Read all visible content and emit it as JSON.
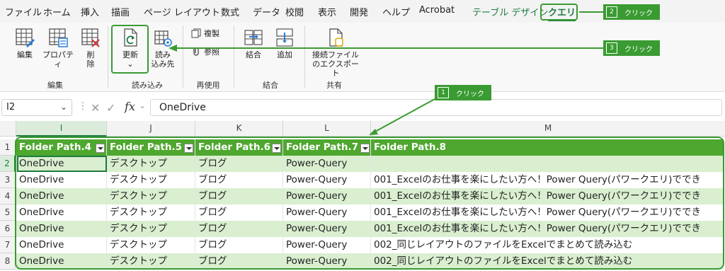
{
  "menu": {
    "items": [
      "ファイル",
      "ホーム",
      "挿入",
      "描画",
      "ページ レイアウト",
      "数式",
      "データ",
      "校閲",
      "表示",
      "開発",
      "ヘルプ",
      "Acrobat"
    ],
    "context_tab": "テーブル デザイン",
    "active_tab": "クエリ"
  },
  "ribbon": {
    "edit": "編集",
    "properties": "プロパティ",
    "delete": "削\n除",
    "refresh": "更新",
    "refresh_caret": "⌄",
    "load_to": "読み\n込み先",
    "duplicate": "複製",
    "reference": "参照",
    "merge": "結合",
    "append": "追加",
    "export": "接続ファイル\nのエクスポート",
    "groups": {
      "edit": "編集",
      "load": "読み込み",
      "reuse": "再使用",
      "combine": "結合",
      "share": "共有"
    }
  },
  "formula_bar": {
    "name_box": "I2",
    "fx": "fx",
    "value": "OneDrive"
  },
  "grid": {
    "columns": [
      "I",
      "J",
      "K",
      "L",
      "M"
    ],
    "row_numbers": [
      "1",
      "2",
      "3",
      "4",
      "5",
      "6",
      "7",
      "8"
    ],
    "headers": [
      "Folder Path.4",
      "Folder Path.5",
      "Folder Path.6",
      "Folder Path.7",
      "Folder Path.8"
    ],
    "rows": [
      [
        "OneDrive",
        "デスクトップ",
        "ブログ",
        "Power-Query",
        ""
      ],
      [
        "OneDrive",
        "デスクトップ",
        "ブログ",
        "Power-Query",
        "001_Excelのお仕事を楽にしたい方へ！Power Query(パワークエリ)ででき"
      ],
      [
        "OneDrive",
        "デスクトップ",
        "ブログ",
        "Power-Query",
        "001_Excelのお仕事を楽にしたい方へ！Power Query(パワークエリ)ででき"
      ],
      [
        "OneDrive",
        "デスクトップ",
        "ブログ",
        "Power-Query",
        "001_Excelのお仕事を楽にしたい方へ！Power Query(パワークエリ)ででき"
      ],
      [
        "OneDrive",
        "デスクトップ",
        "ブログ",
        "Power-Query",
        "001_Excelのお仕事を楽にしたい方へ！Power Query(パワークエリ)ででき"
      ],
      [
        "OneDrive",
        "デスクトップ",
        "ブログ",
        "Power-Query",
        "002_同じレイアウトのファイルをExcelでまとめて読み込む"
      ],
      [
        "OneDrive",
        "デスクトップ",
        "ブログ",
        "Power-Query",
        "002_同じレイアウトのファイルをExcelでまとめて読み込む"
      ]
    ]
  },
  "callouts": [
    {
      "num": "1",
      "text": "クリック"
    },
    {
      "num": "2",
      "text": "クリック"
    },
    {
      "num": "3",
      "text": "クリック"
    }
  ],
  "colors": {
    "accent": "#3a9b32",
    "table_header": "#4ea72e",
    "band": "#d9efd0",
    "selection": "#1e7b40"
  }
}
